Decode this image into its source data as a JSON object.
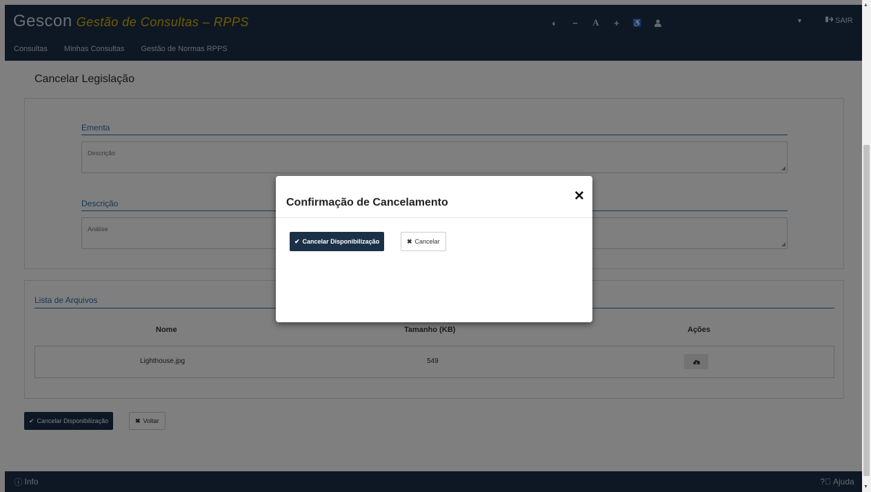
{
  "header": {
    "brand_main": "Gescon",
    "brand_sub": "Gestão de Consultas – RPPS",
    "tools": [
      {
        "icon": "contrast-icon",
        "glyph": "◐"
      },
      {
        "icon": "font-decrease-icon",
        "glyph": "−"
      },
      {
        "icon": "font-size-icon",
        "glyph": "A"
      },
      {
        "icon": "font-increase-icon",
        "glyph": "+"
      },
      {
        "icon": "accessibility-icon",
        "glyph": "♿"
      },
      {
        "icon": "user-icon",
        "glyph": "👤"
      }
    ],
    "logout_label": "SAIR",
    "nav": [
      "Consultas",
      "Minhas Consultas",
      "Gestão de Normas RPPS"
    ]
  },
  "page": {
    "title": "Cancelar Legislação",
    "ementa_label": "Ementa",
    "ementa_value": "Descrição",
    "descricao_label": "Descrição",
    "descricao_value": "Análise",
    "files_title": "Lista de Arquivos",
    "columns": [
      "Nome",
      "Tamanho (KB)",
      "Ações"
    ],
    "rows": [
      {
        "name": "Lighthouse.jpg",
        "size": "549"
      }
    ],
    "cancel_button": "Cancelar Disponibilização",
    "back_button": "Voltar"
  },
  "footer": {
    "info": "Info",
    "help": "Ajuda"
  },
  "modal": {
    "title": "Confirmação de Cancelamento",
    "confirm_button": "Cancelar Disponibilização",
    "cancel_button": "Cancelar"
  },
  "colors": {
    "header": "#1b3148",
    "brand_sub": "#e4b400",
    "field_label": "#2a6fb0"
  }
}
